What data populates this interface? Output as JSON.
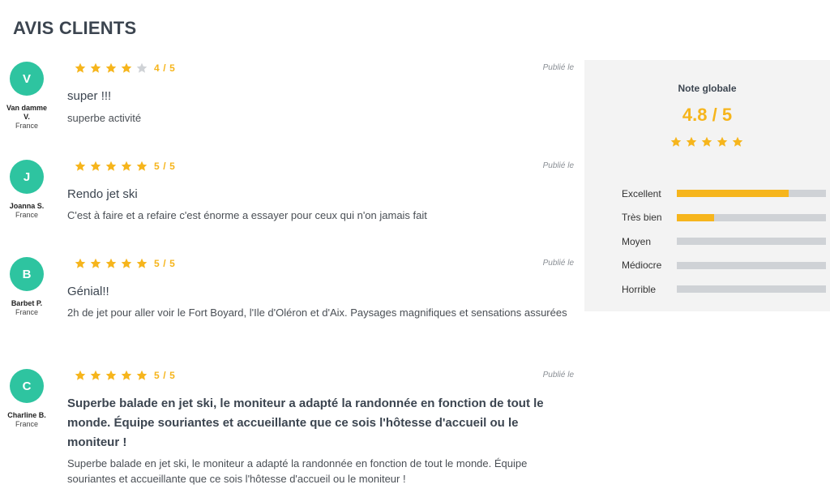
{
  "page_title": "AVIS CLIENTS",
  "colors": {
    "accent": "#f6b51c",
    "avatar": "#2ec4a0",
    "star_empty": "#cfd2d6"
  },
  "reviews": [
    {
      "initial": "V",
      "author": "Van damme V.",
      "country": "France",
      "rating": 4,
      "score_label": "4 / 5",
      "published": "Publié le",
      "title": "super !!!",
      "body": "superbe activité"
    },
    {
      "initial": "J",
      "author": "Joanna S.",
      "country": "France",
      "rating": 5,
      "score_label": "5 / 5",
      "published": "Publié le",
      "title": "Rendo jet ski",
      "body": "C'est à faire et a refaire c'est énorme a essayer pour ceux qui n'on jamais fait"
    },
    {
      "initial": "B",
      "author": "Barbet P.",
      "country": "France",
      "rating": 5,
      "score_label": "5 / 5",
      "published": "Publié le",
      "title": "Génial!!",
      "body": "2h de jet pour aller voir le Fort Boyard, l'Ile d'Oléron et d'Aix. Paysages magnifiques et sensations assurées"
    },
    {
      "initial": "C",
      "author": "Charline B.",
      "country": "France",
      "rating": 5,
      "score_label": "5 / 5",
      "published": "Publié le",
      "title": "Superbe balade en jet ski, le moniteur a adapté la randonnée en fonction de tout le monde. Équipe souriantes et accueillante que ce sois l'hôtesse d'accueil ou le moniteur !",
      "body": "Superbe balade en jet ski, le moniteur a adapté la randonnée en fonction de tout le monde. Équipe souriantes et accueillante que ce sois l'hôtesse d'accueil ou le moniteur !"
    }
  ],
  "summary": {
    "label": "Note globale",
    "value": "4.8 / 5",
    "stars": 5,
    "breakdown": [
      {
        "label": "Excellent",
        "fraction": 0.75
      },
      {
        "label": "Très bien",
        "fraction": 0.25
      },
      {
        "label": "Moyen",
        "fraction": 0
      },
      {
        "label": "Médiocre",
        "fraction": 0
      },
      {
        "label": "Horrible",
        "fraction": 0
      }
    ]
  }
}
